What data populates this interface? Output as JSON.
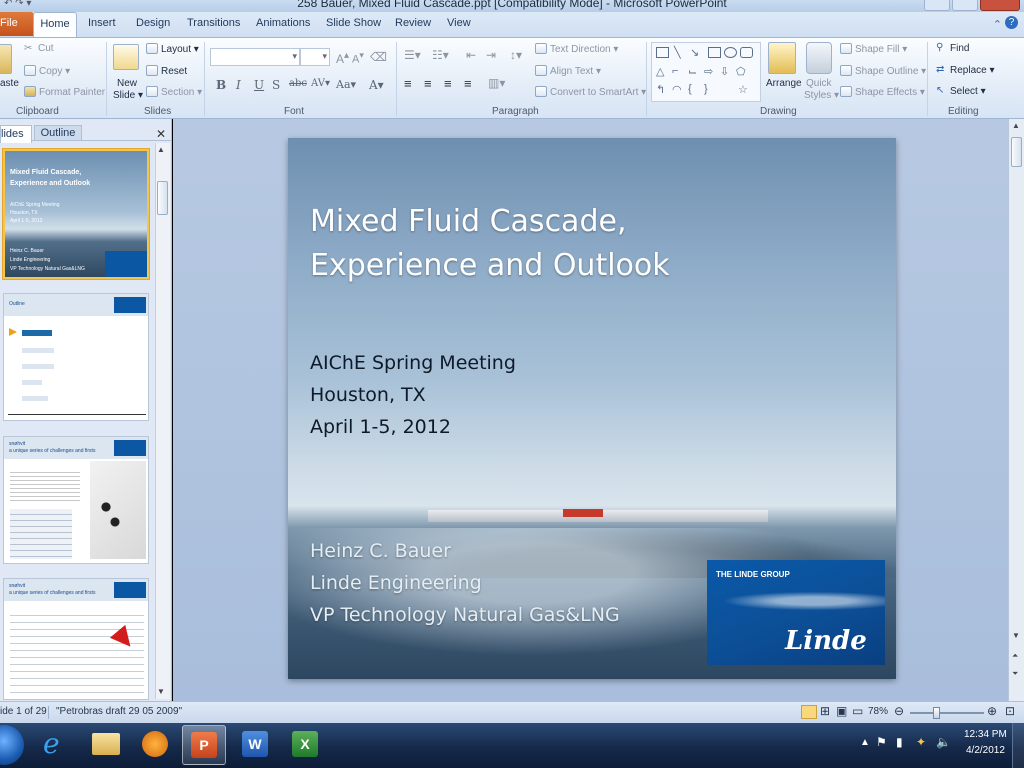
{
  "window": {
    "title": "258 Bauer, Mixed Fluid Cascade.ppt [Compatibility Mode] - Microsoft PowerPoint"
  },
  "tabs": [
    "File",
    "Home",
    "Insert",
    "Design",
    "Transitions",
    "Animations",
    "Slide Show",
    "Review",
    "View"
  ],
  "ribbon": {
    "clipboard": {
      "label": "Clipboard",
      "paste": "aste",
      "cut": "Cut",
      "copy": "Copy",
      "format_painter": "Format Painter"
    },
    "slides": {
      "label": "Slides",
      "new_slide": "New",
      "new_slide2": "Slide",
      "layout": "Layout",
      "reset": "Reset",
      "section": "Section"
    },
    "font": {
      "label": "Font"
    },
    "paragraph": {
      "label": "Paragraph",
      "text_direction": "Text Direction",
      "align_text": "Align Text",
      "convert_smartart": "Convert to SmartArt"
    },
    "drawing": {
      "label": "Drawing",
      "arrange": "Arrange",
      "quick_styles": "Quick",
      "quick_styles2": "Styles",
      "shape_fill": "Shape Fill",
      "shape_outline": "Shape Outline",
      "shape_effects": "Shape Effects"
    },
    "editing": {
      "label": "Editing",
      "find": "Find",
      "replace": "Replace",
      "select": "Select"
    }
  },
  "left_pane": {
    "tabs": [
      "lides",
      "Outline"
    ],
    "thumb1": {
      "title": "Mixed Fluid Cascade, Experience and Outlook",
      "meta": [
        "AIChE Spring Meeting",
        "Houston, TX",
        "April 1-5, 2012"
      ],
      "author": [
        "Heinz C. Bauer",
        "Linde Engineering",
        "VP Technology Natural Gas&LNG"
      ]
    },
    "thumb2": {
      "title": "Outline"
    },
    "thumb3": {
      "title": "snøhvit",
      "subtitle": "a unique series of challenges and firsts"
    },
    "thumb4": {
      "title": "snøhvit",
      "subtitle": "a unique series of challenges and firsts"
    }
  },
  "slide": {
    "title_line1": "Mixed Fluid Cascade,",
    "title_line2": "Experience and Outlook",
    "meeting": "AIChE Spring Meeting",
    "location": "Houston, TX",
    "date": "April 1-5, 2012",
    "author": "Heinz C. Bauer",
    "company": "Linde Engineering",
    "position": "VP Technology Natural Gas&LNG",
    "logo_group": "THE LINDE GROUP",
    "logo_name": "Linde"
  },
  "status": {
    "slide_info": "ide 1 of 29",
    "theme": "\"Petrobras draft 29 05 2009\"",
    "zoom": "78%"
  },
  "tray": {
    "time": "12:34 PM",
    "date": "4/2/2012"
  }
}
